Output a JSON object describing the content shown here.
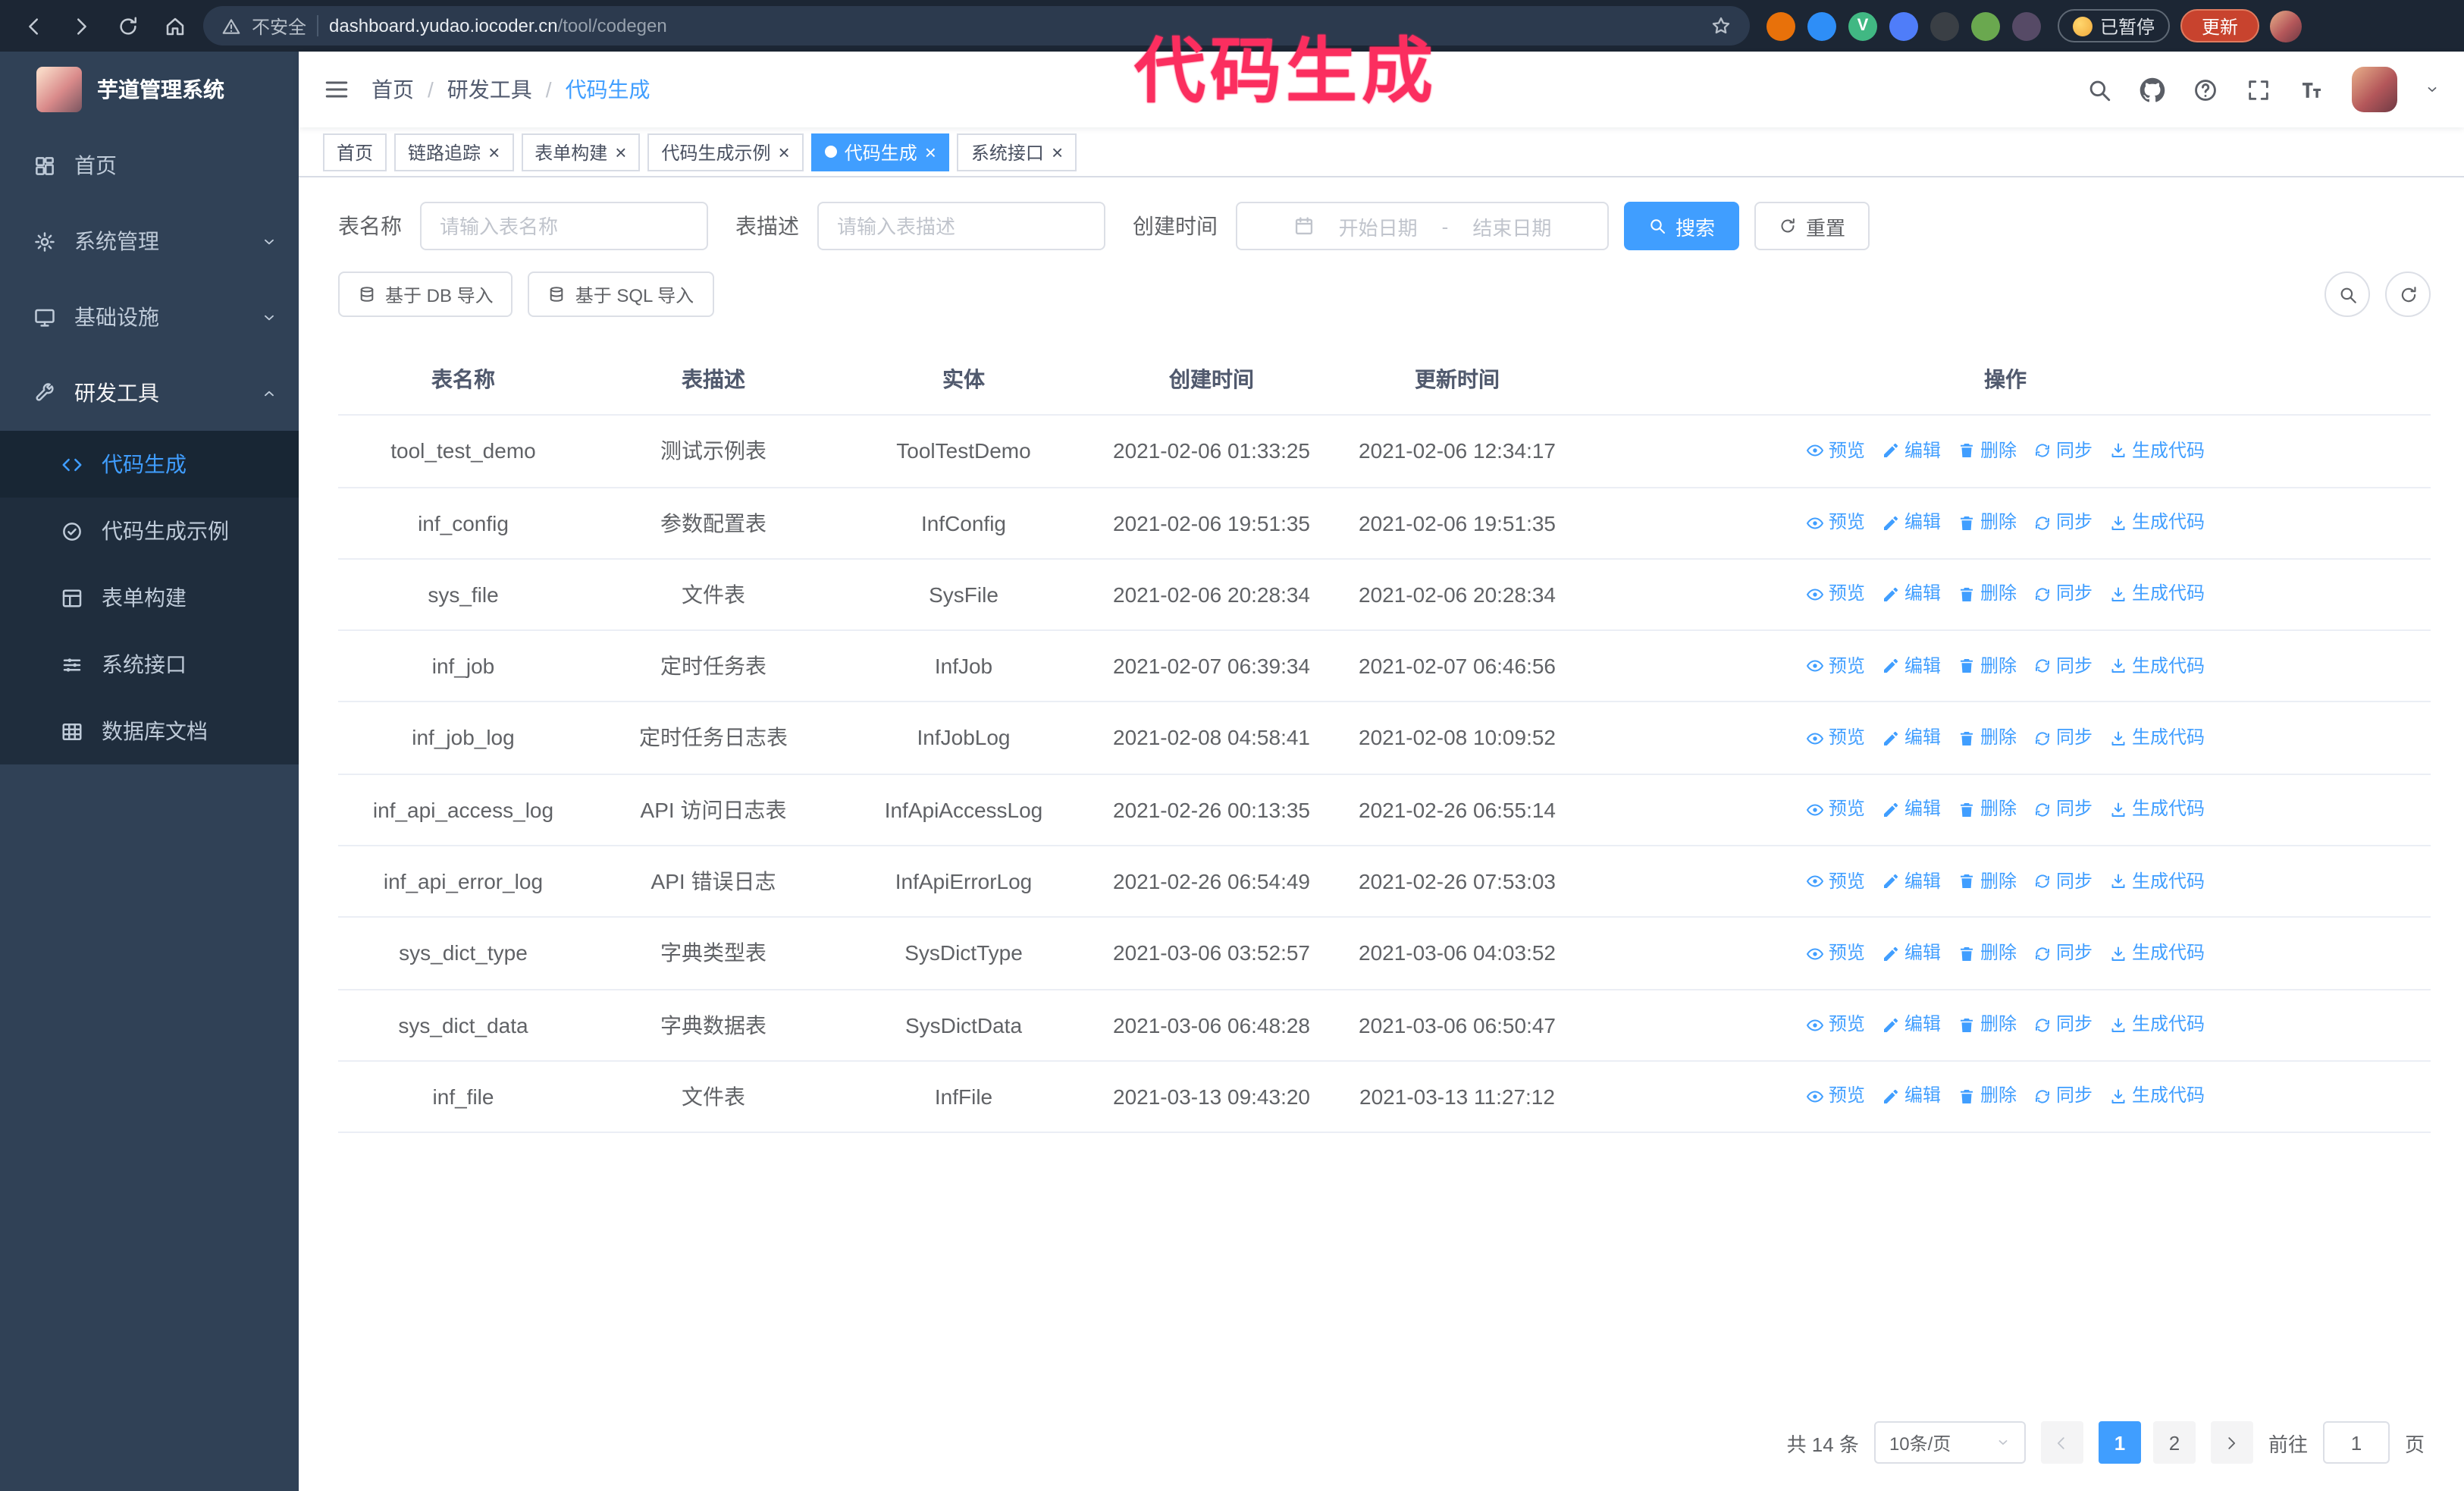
{
  "browser": {
    "security_label": "不安全",
    "url_host": "dashboard.yudao.iocoder.cn",
    "url_path": "/tool/codegen",
    "paused_badge": "已暂停",
    "update_button": "更新",
    "extensions": [
      {
        "name": "fox-extension-icon",
        "color": "#e8710a",
        "glyph": ""
      },
      {
        "name": "water-extension-icon",
        "color": "#2e8ef7",
        "glyph": ""
      },
      {
        "name": "vue-devtools-extension-icon",
        "color": "#41b883",
        "glyph": "V"
      },
      {
        "name": "contacts-extension-icon",
        "color": "#4f7df9",
        "glyph": ""
      },
      {
        "name": "tampermonkey-extension-icon",
        "color": "#3a3f45",
        "glyph": ""
      },
      {
        "name": "leaf-extension-icon",
        "color": "#6aa84f",
        "glyph": ""
      },
      {
        "name": "paw-extension-icon",
        "color": "#564a66",
        "glyph": ""
      }
    ]
  },
  "annotation": {
    "text": "代码生成",
    "color": "#fb2e5f"
  },
  "sidebar": {
    "logo_title": "芋道管理系统",
    "items": [
      {
        "id": "home",
        "label": "首页",
        "icon": "dashboard"
      },
      {
        "id": "system",
        "label": "系统管理",
        "icon": "gear",
        "chevron": "down"
      },
      {
        "id": "infra",
        "label": "基础设施",
        "icon": "monitor",
        "chevron": "down"
      },
      {
        "id": "devtools",
        "label": "研发工具",
        "icon": "tools",
        "chevron": "up",
        "expanded": true
      }
    ],
    "subitems": [
      {
        "id": "codegen",
        "label": "代码生成",
        "icon": "code",
        "active": true
      },
      {
        "id": "codegen-example",
        "label": "代码生成示例",
        "icon": "badge"
      },
      {
        "id": "form-builder",
        "label": "表单构建",
        "icon": "form"
      },
      {
        "id": "system-api",
        "label": "系统接口",
        "icon": "sliders"
      },
      {
        "id": "db-doc",
        "label": "数据库文档",
        "icon": "dbtable"
      }
    ]
  },
  "navbar": {
    "breadcrumb": [
      "首页",
      "研发工具",
      "代码生成"
    ],
    "separator": "/"
  },
  "tabs": [
    {
      "label": "首页",
      "closable": false,
      "active": false
    },
    {
      "label": "链路追踪",
      "closable": true,
      "active": false
    },
    {
      "label": "表单构建",
      "closable": true,
      "active": false
    },
    {
      "label": "代码生成示例",
      "closable": true,
      "active": false
    },
    {
      "label": "代码生成",
      "closable": true,
      "active": true
    },
    {
      "label": "系统接口",
      "closable": true,
      "active": false
    }
  ],
  "filters": {
    "table_name_label": "表名称",
    "table_name_placeholder": "请输入表名称",
    "table_desc_label": "表描述",
    "table_desc_placeholder": "请输入表描述",
    "create_time_label": "创建时间",
    "date_start_placeholder": "开始日期",
    "date_separator": "-",
    "date_end_placeholder": "结束日期",
    "search_button": "搜索",
    "reset_button": "重置"
  },
  "toolbar": {
    "import_db_button": "基于 DB 导入",
    "import_sql_button": "基于 SQL 导入"
  },
  "table": {
    "columns": [
      "表名称",
      "表描述",
      "实体",
      "创建时间",
      "更新时间",
      "操作"
    ],
    "actions": [
      "预览",
      "编辑",
      "删除",
      "同步",
      "生成代码"
    ],
    "rows": [
      {
        "name": "tool_test_demo",
        "desc": "测试示例表",
        "entity": "ToolTestDemo",
        "created": "2021-02-06 01:33:25",
        "updated": "2021-02-06 12:34:17"
      },
      {
        "name": "inf_config",
        "desc": "参数配置表",
        "entity": "InfConfig",
        "created": "2021-02-06 19:51:35",
        "updated": "2021-02-06 19:51:35"
      },
      {
        "name": "sys_file",
        "desc": "文件表",
        "entity": "SysFile",
        "created": "2021-02-06 20:28:34",
        "updated": "2021-02-06 20:28:34"
      },
      {
        "name": "inf_job",
        "desc": "定时任务表",
        "entity": "InfJob",
        "created": "2021-02-07 06:39:34",
        "updated": "2021-02-07 06:46:56"
      },
      {
        "name": "inf_job_log",
        "desc": "定时任务日志表",
        "entity": "InfJobLog",
        "created": "2021-02-08 04:58:41",
        "updated": "2021-02-08 10:09:52"
      },
      {
        "name": "inf_api_access_log",
        "desc": "API 访问日志表",
        "entity": "InfApiAccessLog",
        "created": "2021-02-26 00:13:35",
        "updated": "2021-02-26 06:55:14"
      },
      {
        "name": "inf_api_error_log",
        "desc": "API 错误日志",
        "entity": "InfApiErrorLog",
        "created": "2021-02-26 06:54:49",
        "updated": "2021-02-26 07:53:03"
      },
      {
        "name": "sys_dict_type",
        "desc": "字典类型表",
        "entity": "SysDictType",
        "created": "2021-03-06 03:52:57",
        "updated": "2021-03-06 04:03:52"
      },
      {
        "name": "sys_dict_data",
        "desc": "字典数据表",
        "entity": "SysDictData",
        "created": "2021-03-06 06:48:28",
        "updated": "2021-03-06 06:50:47"
      },
      {
        "name": "inf_file",
        "desc": "文件表",
        "entity": "InfFile",
        "created": "2021-03-13 09:43:20",
        "updated": "2021-03-13 11:27:12"
      }
    ]
  },
  "pagination": {
    "total_text": "共 14 条",
    "page_size": "10条/页",
    "pages": [
      "1",
      "2"
    ],
    "active_page": "1",
    "goto_label": "前往",
    "goto_value": "1",
    "goto_suffix": "页"
  },
  "colors": {
    "primary": "#409eff",
    "annotation": "#fb2e5f",
    "update_chip": "#c8432e",
    "sidebar_bg": "#304156",
    "submenu_bg": "#1f2d3d"
  }
}
